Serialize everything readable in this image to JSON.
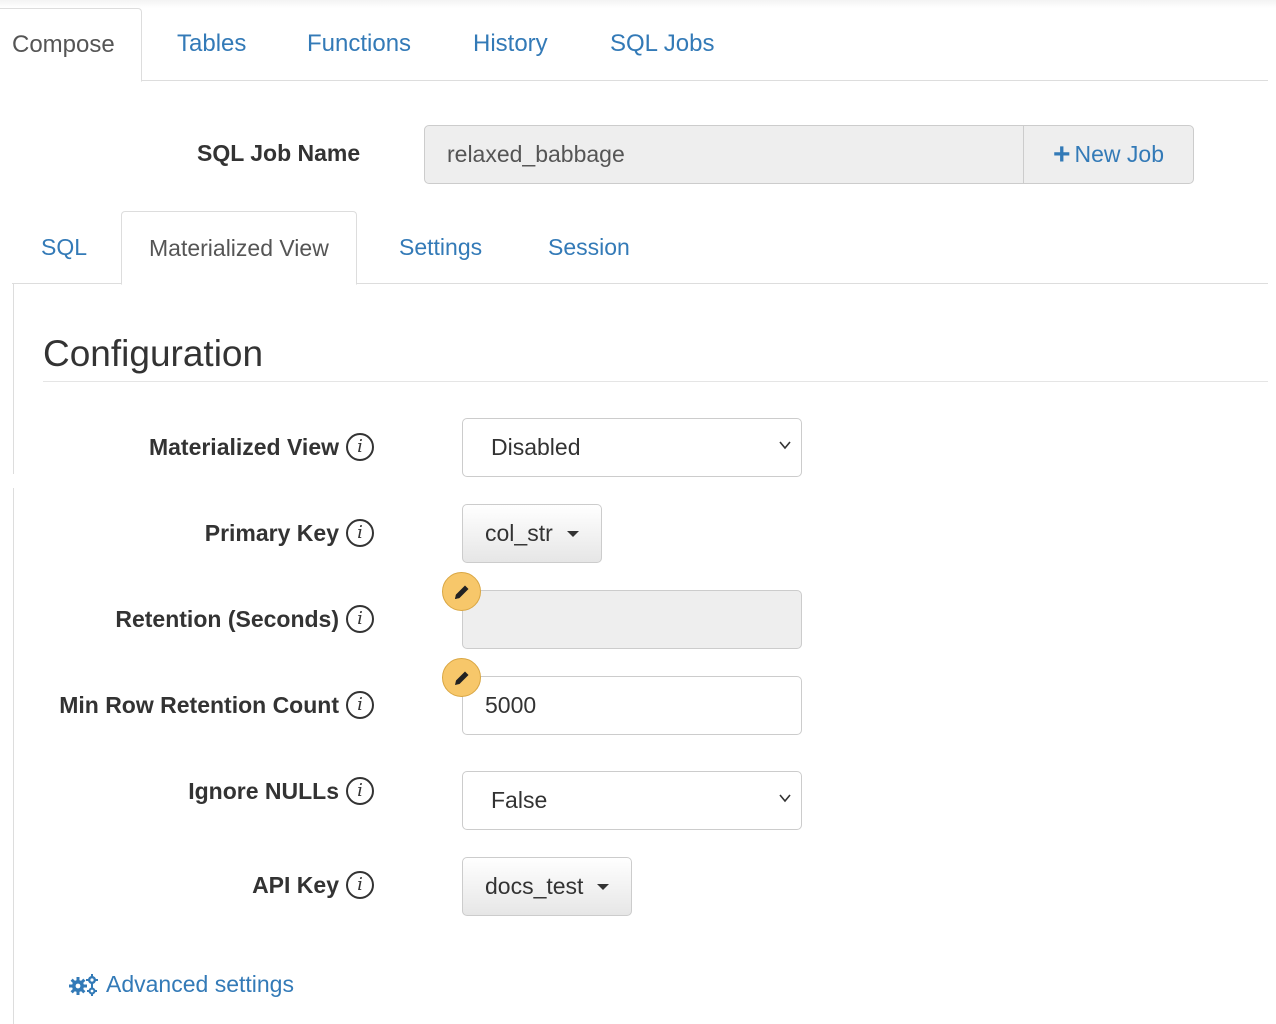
{
  "top_tabs": [
    {
      "label": "Compose",
      "active": true
    },
    {
      "label": "Tables"
    },
    {
      "label": "Functions"
    },
    {
      "label": "History"
    },
    {
      "label": "SQL Jobs"
    }
  ],
  "job": {
    "label": "SQL Job Name",
    "value": "relaxed_babbage",
    "new_job_label": "New Job"
  },
  "sub_tabs": [
    {
      "label": "SQL"
    },
    {
      "label": "Materialized View",
      "active": true
    },
    {
      "label": "Settings"
    },
    {
      "label": "Session"
    }
  ],
  "config": {
    "title": "Configuration",
    "fields": {
      "materialized_view": {
        "label": "Materialized View",
        "value": "Disabled"
      },
      "primary_key": {
        "label": "Primary Key",
        "value": "col_str"
      },
      "retention": {
        "label": "Retention (Seconds)",
        "value": ""
      },
      "min_row_retention": {
        "label": "Min Row Retention Count",
        "value": "5000"
      },
      "ignore_nulls": {
        "label": "Ignore NULLs",
        "value": "False"
      },
      "api_key": {
        "label": "API Key",
        "value": "docs_test"
      }
    },
    "advanced_label": "Advanced settings"
  },
  "colors": {
    "link": "#337ab7",
    "edit_badge": "#f7c76a",
    "disabled_bg": "#eeeeee"
  },
  "icons": {
    "info": "info-circle-icon",
    "edit": "pencil-icon",
    "advanced": "gears-icon",
    "new_job": "plus-icon"
  }
}
